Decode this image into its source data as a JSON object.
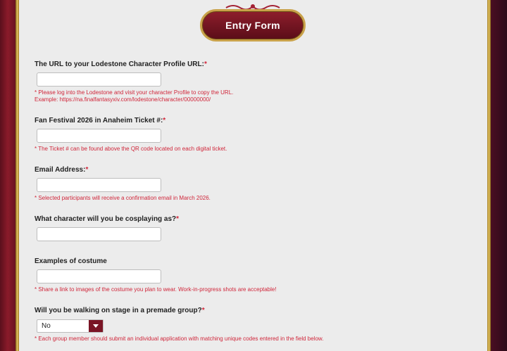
{
  "form": {
    "title": "Entry Form",
    "required_mark": "*",
    "fields": {
      "lodestone": {
        "label": "The URL to your Lodestone Character Profile URL:",
        "value": "",
        "note_1": "* Please log into the Lodestone and visit your character Profile to copy the URL.",
        "note_2": "Example: https://na.finalfantasyxiv.com/lodestone/character/00000000/"
      },
      "ticket": {
        "label": "Fan Festival 2026 in Anaheim Ticket #:",
        "value": "",
        "note": "* The Ticket # can be found above the QR code located on each digital ticket."
      },
      "email": {
        "label": "Email Address:",
        "value": "",
        "note": "* Selected participants will receive a confirmation email in March 2026."
      },
      "character": {
        "label": "What character will you be cosplaying as?",
        "value": ""
      },
      "costume": {
        "label": "Examples of costume",
        "value": "",
        "note": "* Share a link to images of the costume you plan to wear. Work-in-progress shots are acceptable!"
      },
      "group": {
        "label": "Will you be walking on stage in a premade group?",
        "selected": "No",
        "note": "* Each group member should submit an individual application with matching unique codes entered in the field below."
      }
    }
  },
  "colors": {
    "accent_red": "#d0263a",
    "button_maroon": "#7a1525",
    "gold": "#c9a24a",
    "panel_bg": "#ececec"
  },
  "icons": {
    "dropdown": "chevron-down-icon",
    "ornament": "ornament-icon"
  }
}
